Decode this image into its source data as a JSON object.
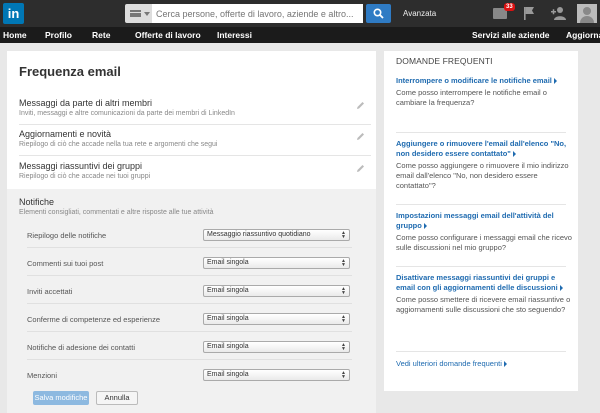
{
  "header": {
    "logo": "in",
    "search_placeholder": "Cerca persone, offerte di lavoro, aziende e altro...",
    "advanced": "Avanzata",
    "mail_badge": "33"
  },
  "nav": {
    "items": [
      "Home",
      "Profilo",
      "Rete",
      "Offerte di lavoro",
      "Interessi",
      "Servizi alle aziende",
      "Aggiorna"
    ]
  },
  "main": {
    "title": "Frequenza email",
    "sections": [
      {
        "title": "Messaggi da parte di altri membri",
        "desc": "Inviti, messaggi e altre comunicazioni da parte dei membri di LinkedIn"
      },
      {
        "title": "Aggiornamenti e novità",
        "desc": "Riepilogo di ciò che accade nella tua rete e argomenti che segui"
      },
      {
        "title": "Messaggi riassuntivi dei gruppi",
        "desc": "Riepilogo di ciò che accade nei tuoi gruppi"
      }
    ],
    "notifications": {
      "title": "Notifiche",
      "desc": "Elementi consigliati, commentati e altre risposte alle tue attività",
      "rows": [
        {
          "label": "Riepilogo delle notifiche",
          "value": "Messaggio riassuntivo quotidiano"
        },
        {
          "label": "Commenti sui tuoi post",
          "value": "Email singola"
        },
        {
          "label": "Inviti accettati",
          "value": "Email singola"
        },
        {
          "label": "Conferme di competenze ed esperienze",
          "value": "Email singola"
        },
        {
          "label": "Notifiche di adesione dei contatti",
          "value": "Email singola"
        },
        {
          "label": "Menzioni",
          "value": "Email singola"
        }
      ]
    },
    "save_label": "Salva modifiche",
    "cancel_label": "Annulla"
  },
  "faq": {
    "title": "DOMANDE FREQUENTI",
    "items": [
      {
        "link": "Interrompere o modificare le notifiche email",
        "text": "Come posso interrompere le notifiche email o cambiare la frequenza?"
      },
      {
        "link": "Aggiungere o rimuovere l'email dall'elenco \"No, non desidero essere contattato\"",
        "text": "Come posso aggiungere o rimuovere il mio indirizzo email dall'elenco \"No, non desidero essere contattato\"?"
      },
      {
        "link": "Impostazioni messaggi email dell'attività del gruppo",
        "text": "Come posso configurare i messaggi email che ricevo sulle discussioni nel mio gruppo?"
      },
      {
        "link": "Disattivare messaggi riassuntivi dei gruppi e email con gli aggiornamenti delle discussioni",
        "text": "Come posso smettere di ricevere email riassuntive o aggiornamenti sulle discussioni che sto seguendo?"
      }
    ],
    "more": "Vedi ulteriori domande frequenti"
  }
}
